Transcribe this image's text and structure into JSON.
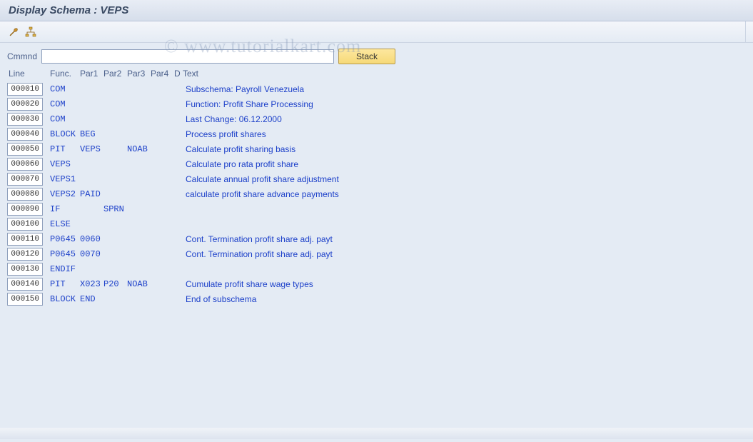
{
  "title": "Display Schema : VEPS",
  "watermark": "© www.tutorialkart.com",
  "cmd_label": "Cmmnd",
  "cmd_value": "",
  "stack_label": "Stack",
  "headers": {
    "line": "Line",
    "func": "Func.",
    "par1": "Par1",
    "par2": "Par2",
    "par3": "Par3",
    "par4": "Par4",
    "d": "D",
    "text": "Text"
  },
  "rows": [
    {
      "line": "000010",
      "func": "COM",
      "par1": "",
      "par2": "",
      "par3": "",
      "par4": "",
      "d": "",
      "text": "Subschema: Payroll Venezuela"
    },
    {
      "line": "000020",
      "func": "COM",
      "par1": "",
      "par2": "",
      "par3": "",
      "par4": "",
      "d": "",
      "text": "Function: Profit Share Processing"
    },
    {
      "line": "000030",
      "func": "COM",
      "par1": "",
      "par2": "",
      "par3": "",
      "par4": "",
      "d": "",
      "text": "Last Change: 06.12.2000"
    },
    {
      "line": "000040",
      "func": "BLOCK",
      "par1": "BEG",
      "par2": "",
      "par3": "",
      "par4": "",
      "d": "",
      "text": "Process profit shares"
    },
    {
      "line": "000050",
      "func": "PIT",
      "par1": "VEPS",
      "par2": "",
      "par3": "NOAB",
      "par4": "",
      "d": "",
      "text": "Calculate profit sharing basis"
    },
    {
      "line": "000060",
      "func": "VEPS",
      "par1": "",
      "par2": "",
      "par3": "",
      "par4": "",
      "d": "",
      "text": "Calculate pro rata profit share"
    },
    {
      "line": "000070",
      "func": "VEPS1",
      "par1": "",
      "par2": "",
      "par3": "",
      "par4": "",
      "d": "",
      "text": "Calculate annual profit share adjustment"
    },
    {
      "line": "000080",
      "func": "VEPS2",
      "par1": "PAID",
      "par2": "",
      "par3": "",
      "par4": "",
      "d": "",
      "text": "calculate profit share advance payments"
    },
    {
      "line": "000090",
      "func": "IF",
      "par1": "",
      "par2": "SPRN",
      "par3": "",
      "par4": "",
      "d": "",
      "text": ""
    },
    {
      "line": "000100",
      "func": "ELSE",
      "par1": "",
      "par2": "",
      "par3": "",
      "par4": "",
      "d": "",
      "text": ""
    },
    {
      "line": "000110",
      "func": "P0645",
      "par1": "0060",
      "par2": "",
      "par3": "",
      "par4": "",
      "d": "",
      "text": "Cont. Termination profit share adj. payt"
    },
    {
      "line": "000120",
      "func": "P0645",
      "par1": "0070",
      "par2": "",
      "par3": "",
      "par4": "",
      "d": "",
      "text": "Cont. Termination profit share adj. payt"
    },
    {
      "line": "000130",
      "func": "ENDIF",
      "par1": "",
      "par2": "",
      "par3": "",
      "par4": "",
      "d": "",
      "text": ""
    },
    {
      "line": "000140",
      "func": "PIT",
      "par1": "X023",
      "par2": "P20",
      "par3": "NOAB",
      "par4": "",
      "d": "",
      "text": "Cumulate profit share wage types"
    },
    {
      "line": "000150",
      "func": "BLOCK",
      "par1": "END",
      "par2": "",
      "par3": "",
      "par4": "",
      "d": "",
      "text": "End of subschema"
    }
  ]
}
